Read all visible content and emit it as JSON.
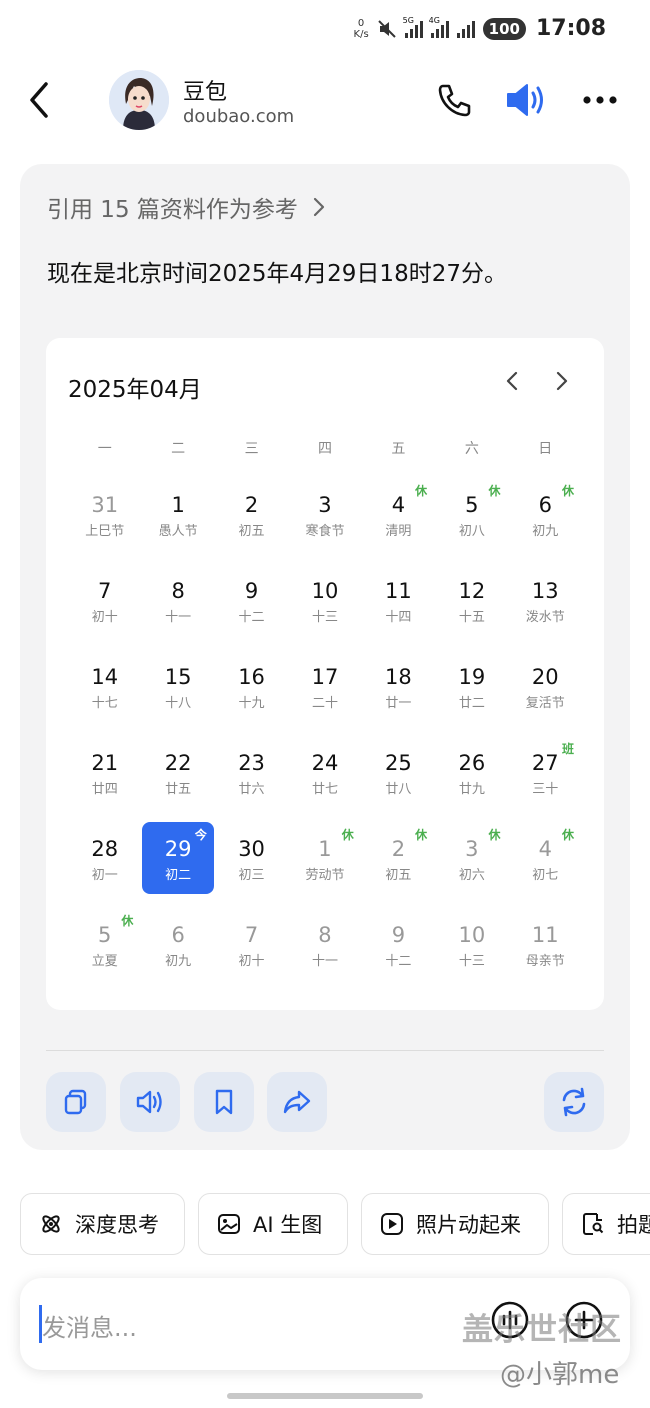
{
  "status_bar": {
    "net_speed_value": "0",
    "net_speed_unit": "K/s",
    "sim1": "5G",
    "sim2": "4G",
    "battery": "100",
    "time": "17:08"
  },
  "header": {
    "bot_name": "豆包",
    "bot_domain": "doubao.com"
  },
  "message": {
    "reference": "引用 15 篇资料作为参考",
    "answer": "现在是北京时间2025年4月29日18时27分。"
  },
  "calendar": {
    "title": "2025年04月",
    "weekdays": [
      "一",
      "二",
      "三",
      "四",
      "五",
      "六",
      "日"
    ],
    "days": [
      {
        "n": "31",
        "s": "上巳节",
        "other": true,
        "badge": ""
      },
      {
        "n": "1",
        "s": "愚人节",
        "other": false,
        "badge": ""
      },
      {
        "n": "2",
        "s": "初五",
        "other": false,
        "badge": ""
      },
      {
        "n": "3",
        "s": "寒食节",
        "other": false,
        "badge": ""
      },
      {
        "n": "4",
        "s": "清明",
        "other": false,
        "badge": "休"
      },
      {
        "n": "5",
        "s": "初八",
        "other": false,
        "badge": "休"
      },
      {
        "n": "6",
        "s": "初九",
        "other": false,
        "badge": "休"
      },
      {
        "n": "7",
        "s": "初十",
        "other": false,
        "badge": ""
      },
      {
        "n": "8",
        "s": "十一",
        "other": false,
        "badge": ""
      },
      {
        "n": "9",
        "s": "十二",
        "other": false,
        "badge": ""
      },
      {
        "n": "10",
        "s": "十三",
        "other": false,
        "badge": ""
      },
      {
        "n": "11",
        "s": "十四",
        "other": false,
        "badge": ""
      },
      {
        "n": "12",
        "s": "十五",
        "other": false,
        "badge": ""
      },
      {
        "n": "13",
        "s": "泼水节",
        "other": false,
        "badge": ""
      },
      {
        "n": "14",
        "s": "十七",
        "other": false,
        "badge": ""
      },
      {
        "n": "15",
        "s": "十八",
        "other": false,
        "badge": ""
      },
      {
        "n": "16",
        "s": "十九",
        "other": false,
        "badge": ""
      },
      {
        "n": "17",
        "s": "二十",
        "other": false,
        "badge": ""
      },
      {
        "n": "18",
        "s": "廿一",
        "other": false,
        "badge": ""
      },
      {
        "n": "19",
        "s": "廿二",
        "other": false,
        "badge": ""
      },
      {
        "n": "20",
        "s": "复活节",
        "other": false,
        "badge": ""
      },
      {
        "n": "21",
        "s": "廿四",
        "other": false,
        "badge": ""
      },
      {
        "n": "22",
        "s": "廿五",
        "other": false,
        "badge": ""
      },
      {
        "n": "23",
        "s": "廿六",
        "other": false,
        "badge": ""
      },
      {
        "n": "24",
        "s": "廿七",
        "other": false,
        "badge": ""
      },
      {
        "n": "25",
        "s": "廿八",
        "other": false,
        "badge": ""
      },
      {
        "n": "26",
        "s": "廿九",
        "other": false,
        "badge": ""
      },
      {
        "n": "27",
        "s": "三十",
        "other": false,
        "badge": "班"
      },
      {
        "n": "28",
        "s": "初一",
        "other": false,
        "badge": ""
      },
      {
        "n": "29",
        "s": "初二",
        "other": false,
        "badge": "今",
        "today": true
      },
      {
        "n": "30",
        "s": "初三",
        "other": false,
        "badge": ""
      },
      {
        "n": "1",
        "s": "劳动节",
        "other": true,
        "badge": "休"
      },
      {
        "n": "2",
        "s": "初五",
        "other": true,
        "badge": "休"
      },
      {
        "n": "3",
        "s": "初六",
        "other": true,
        "badge": "休"
      },
      {
        "n": "4",
        "s": "初七",
        "other": true,
        "badge": "休"
      },
      {
        "n": "5",
        "s": "立夏",
        "other": true,
        "badge": "休"
      },
      {
        "n": "6",
        "s": "初九",
        "other": true,
        "badge": ""
      },
      {
        "n": "7",
        "s": "初十",
        "other": true,
        "badge": ""
      },
      {
        "n": "8",
        "s": "十一",
        "other": true,
        "badge": ""
      },
      {
        "n": "9",
        "s": "十二",
        "other": true,
        "badge": ""
      },
      {
        "n": "10",
        "s": "十三",
        "other": true,
        "badge": ""
      },
      {
        "n": "11",
        "s": "母亲节",
        "other": true,
        "badge": ""
      }
    ]
  },
  "actions": [
    "copy-icon",
    "speaker-icon",
    "bookmark-icon",
    "share-icon",
    "regenerate-icon"
  ],
  "chips": {
    "deep_think": "深度思考",
    "ai_image": "AI 生图",
    "photo_animate": "照片动起来",
    "photo_search": "拍题"
  },
  "input": {
    "placeholder": "发消息..."
  },
  "watermark": {
    "line1": "盖乐世社区",
    "line2": "@小郭me"
  },
  "colors": {
    "accent": "#2f6bef",
    "holiday_badge": "#4caf50",
    "card_bg": "#f3f3f4"
  }
}
